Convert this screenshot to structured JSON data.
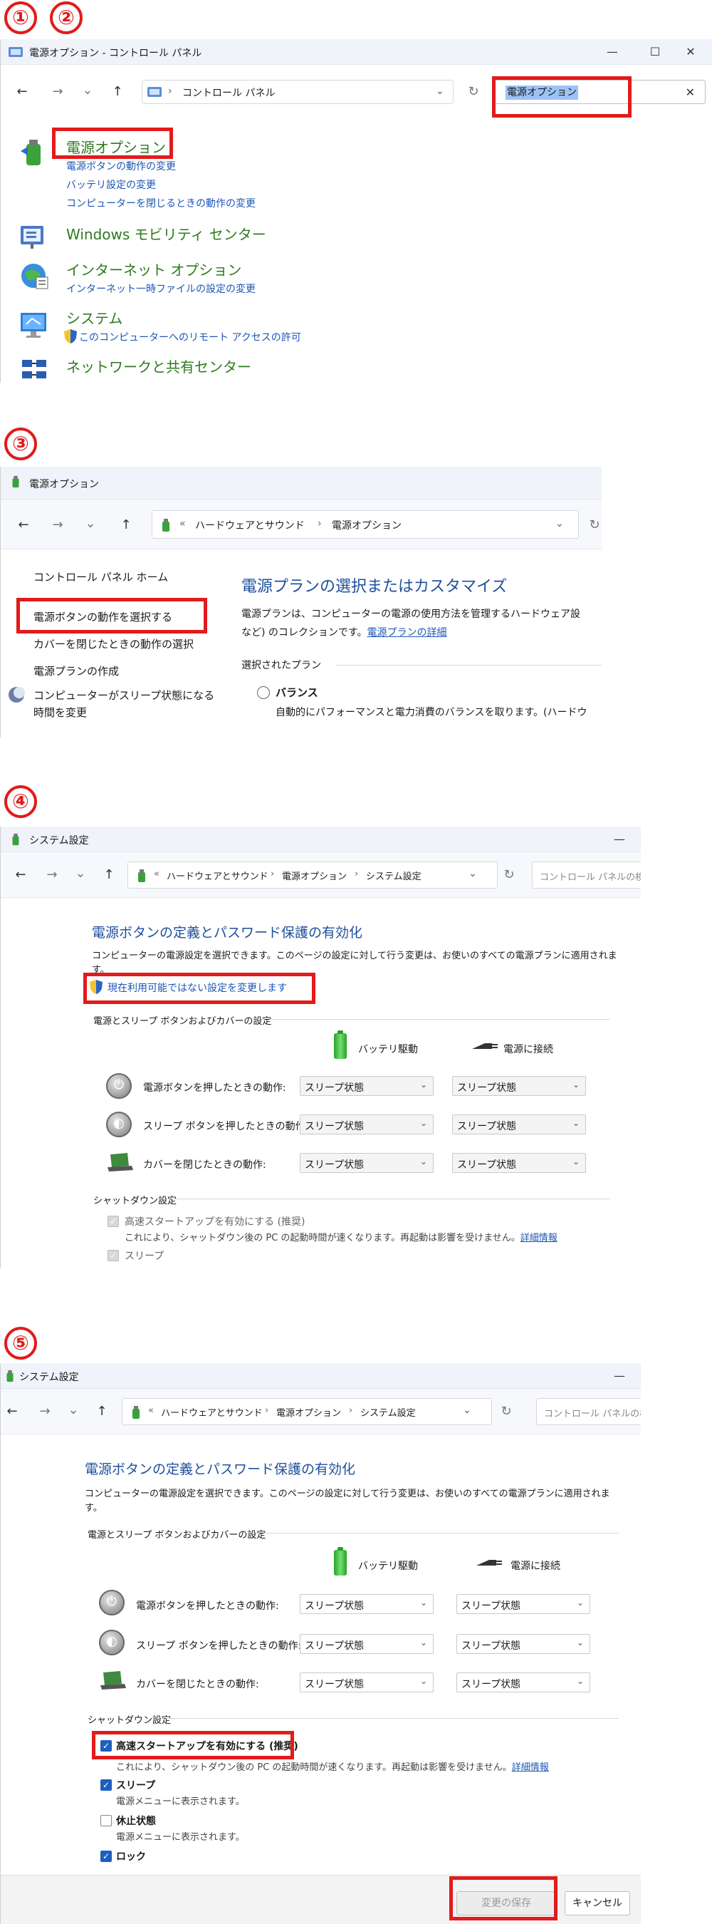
{
  "steps": [
    "①",
    "②",
    "③",
    "④",
    "⑤"
  ],
  "w1": {
    "title": "電源オプション - コントロール パネル",
    "controls": {
      "min": "—",
      "max": "☐",
      "close": "✕"
    },
    "nav": {
      "back": "←",
      "fwd": "→",
      "down": "⌄",
      "up": "↑",
      "refresh": "↻",
      "chev": "⌄",
      "sep": "›"
    },
    "address": "コントロール パネル",
    "search_value": "電源オプション",
    "search_clear": "✕",
    "results": [
      {
        "title": "電源オプション",
        "links": [
          "電源ボタンの動作の変更",
          "バッテリ設定の変更",
          "コンピューターを閉じるときの動作の変更"
        ]
      },
      {
        "title": "Windows モビリティ センター",
        "links": []
      },
      {
        "title": "インターネット オプション",
        "links": [
          "インターネット一時ファイルの設定の変更"
        ]
      },
      {
        "title": "システム",
        "links": [
          "このコンピューターへのリモート アクセスの許可"
        ]
      },
      {
        "title": "ネットワークと共有センター",
        "links": []
      }
    ]
  },
  "w2": {
    "title": "電源オプション",
    "breadcrumb": [
      "«",
      "ハードウェアとサウンド",
      "›",
      "電源オプション"
    ],
    "side": [
      "コントロール パネル ホーム",
      "電源ボタンの動作を選択する",
      "カバーを閉じたときの動作の選択",
      "電源プランの作成",
      "コンピューターがスリープ状態になる",
      "時間を変更"
    ],
    "heading": "電源プランの選択またはカスタマイズ",
    "desc1": "電源プランは、コンピューターの電源の使用方法を管理するハードウェア設",
    "desc2": "など) のコレクションです。",
    "desc_link": "電源プランの詳細",
    "selected_plan": "選択されたプラン",
    "plan_name": "バランス",
    "plan_desc": "自動的にパフォーマンスと電力消費のバランスを取ります。(ハードウ"
  },
  "w3": {
    "title": "システム設定",
    "breadcrumb": [
      "«",
      "ハードウェアとサウンド",
      "›",
      "電源オプション",
      "›",
      "システム設定"
    ],
    "search_placeholder": "コントロール パネルの検索",
    "heading": "電源ボタンの定義とパスワード保護の有効化",
    "desc": "コンピューターの電源設定を選択できます。このページの設定に対して行う変更は、お使いのすべての電源プランに適用されま",
    "desc2": "す。",
    "change_link": "現在利用可能ではない設定を変更します",
    "group1": "電源とスリープ ボタンおよびカバーの設定",
    "col_battery": "バッテリ駆動",
    "col_ac": "電源に接続",
    "rows": [
      {
        "label": "電源ボタンを押したときの動作:",
        "battery": "スリープ状態",
        "ac": "スリープ状態"
      },
      {
        "label": "スリープ ボタンを押したときの動作:",
        "battery": "スリープ状態",
        "ac": "スリープ状態"
      },
      {
        "label": "カバーを閉じたときの動作:",
        "battery": "スリープ状態",
        "ac": "スリープ状態"
      }
    ],
    "group2": "シャットダウン設定",
    "fast_startup": "高速スタートアップを有効にする (推奨)",
    "fast_desc": "これにより、シャットダウン後の PC の起動時間が速くなります。再起動は影響を受けません。",
    "details": "詳細情報",
    "sleep": "スリープ"
  },
  "w4": {
    "title": "システム設定",
    "breadcrumb": [
      "«",
      "ハードウェアとサウンド",
      "›",
      "電源オプション",
      "›",
      "システム設定"
    ],
    "search_placeholder": "コントロール パネルの検",
    "heading": "電源ボタンの定義とパスワード保護の有効化",
    "desc": "コンピューターの電源設定を選択できます。このページの設定に対して行う変更は、お使いのすべての電源プランに適用されま",
    "desc2": "す。",
    "group1": "電源とスリープ ボタンおよびカバーの設定",
    "col_battery": "バッテリ駆動",
    "col_ac": "電源に接続",
    "rows": [
      {
        "label": "電源ボタンを押したときの動作:",
        "battery": "スリープ状態",
        "ac": "スリープ状態"
      },
      {
        "label": "スリープ ボタンを押したときの動作:",
        "battery": "スリープ状態",
        "ac": "スリープ状態"
      },
      {
        "label": "カバーを閉じたときの動作:",
        "battery": "スリープ状態",
        "ac": "スリープ状態"
      }
    ],
    "group2": "シャットダウン設定",
    "fast_startup": "高速スタートアップを有効にする (推奨)",
    "fast_desc": "これにより、シャットダウン後の PC の起動時間が速くなります。再起動は影響を受けません。",
    "details": "詳細情報",
    "sleep": "スリープ",
    "sleep_desc": "電源メニューに表示されます。",
    "hibernate": "休止状態",
    "hibernate_desc": "電源メニューに表示されます。",
    "lock": "ロック",
    "save": "変更の保存",
    "cancel": "キャンセル",
    "checks": {
      "fast": true,
      "sleep": true,
      "hibernate": false,
      "lock": true
    }
  },
  "colors": {
    "highlight": "#e21b1b",
    "link": "#1d56b5",
    "green_title": "#2f7a1f"
  }
}
